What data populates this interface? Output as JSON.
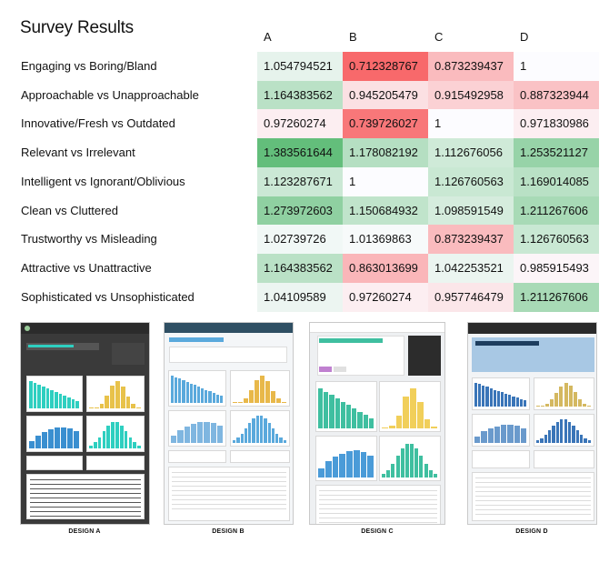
{
  "title": "Survey Results",
  "chart_data": {
    "type": "table",
    "columns": [
      "A",
      "B",
      "C",
      "D"
    ],
    "rows": [
      {
        "label": "Engaging vs Boring/Bland",
        "values": [
          "1.054794521",
          "0.712328767",
          "0.873239437",
          "1"
        ]
      },
      {
        "label": "Approachable vs Unapproachable",
        "values": [
          "1.164383562",
          "0.945205479",
          "0.915492958",
          "0.887323944"
        ]
      },
      {
        "label": "Innovative/Fresh vs Outdated",
        "values": [
          "0.97260274",
          "0.739726027",
          "1",
          "0.971830986"
        ]
      },
      {
        "label": "Relevant vs Irrelevant",
        "values": [
          "1.383561644",
          "1.178082192",
          "1.112676056",
          "1.253521127"
        ]
      },
      {
        "label": "Intelligent vs Ignorant/Oblivious",
        "values": [
          "1.123287671",
          "1",
          "1.126760563",
          "1.169014085"
        ]
      },
      {
        "label": "Clean vs Cluttered",
        "values": [
          "1.273972603",
          "1.150684932",
          "1.098591549",
          "1.211267606"
        ]
      },
      {
        "label": "Trustworthy vs Misleading",
        "values": [
          "1.02739726",
          "1.01369863",
          "0.873239437",
          "1.126760563"
        ]
      },
      {
        "label": "Attractive vs Unattractive",
        "values": [
          "1.164383562",
          "0.863013699",
          "1.042253521",
          "0.985915493"
        ]
      },
      {
        "label": "Sophisticated vs Unsophisticated",
        "values": [
          "1.04109589",
          "0.97260274",
          "0.957746479",
          "1.211267606"
        ]
      }
    ],
    "color_scale": {
      "low": "#f8696b",
      "mid": "#fcfcff",
      "high": "#63be7b"
    }
  },
  "designs": [
    {
      "label": "DESIGN A",
      "theme": "dark",
      "accent": "#2ecfc0"
    },
    {
      "label": "DESIGN B",
      "theme": "light",
      "accent": "#5aa9dc"
    },
    {
      "label": "DESIGN C",
      "theme": "light",
      "accent": "#3fbfa0"
    },
    {
      "label": "DESIGN D",
      "theme": "blue",
      "accent": "#3a75b8"
    }
  ]
}
